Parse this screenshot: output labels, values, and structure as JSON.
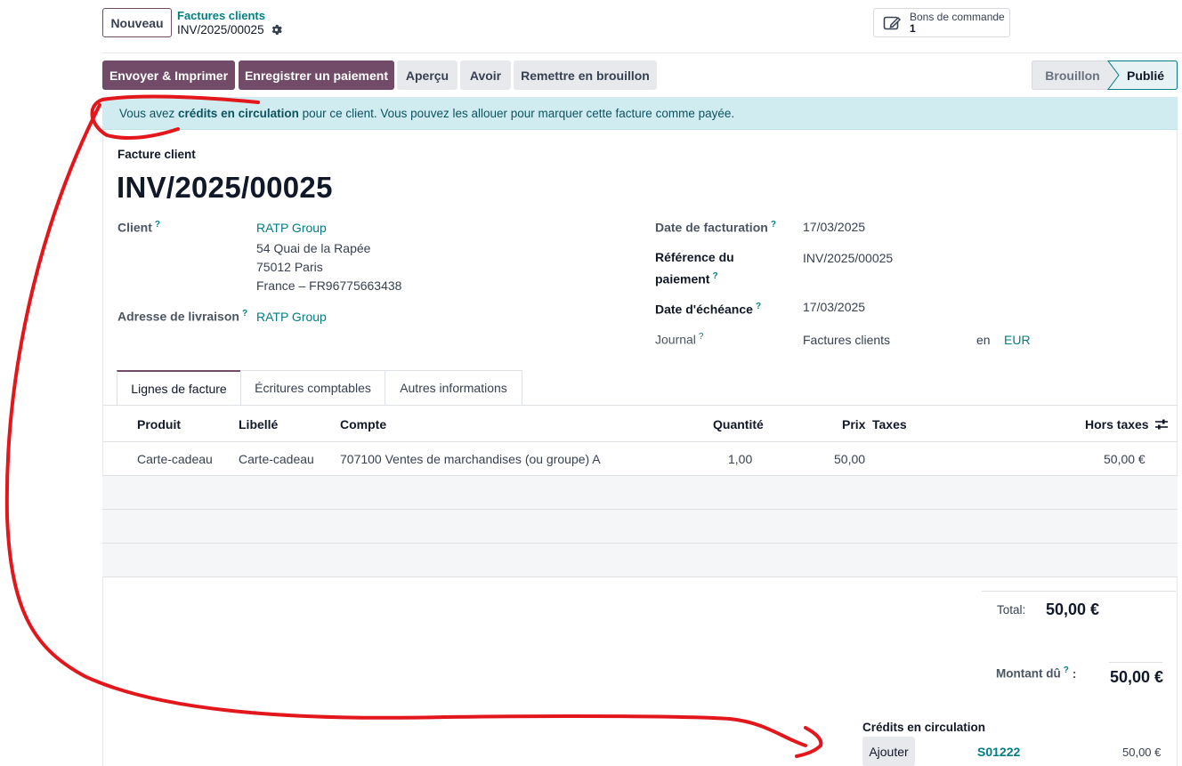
{
  "control": {
    "new_label": "Nouveau",
    "breadcrumb_parent": "Factures clients",
    "breadcrumb_current": "INV/2025/00025"
  },
  "smart_button": {
    "label": "Bons de commande",
    "count": "1"
  },
  "actions": {
    "send_print": "Envoyer & Imprimer",
    "register_payment": "Enregistrer un paiement",
    "preview": "Aperçu",
    "credit_note": "Avoir",
    "reset_draft": "Remettre en brouillon"
  },
  "status": {
    "stages": [
      "Brouillon",
      "Publié"
    ],
    "current": "Publié"
  },
  "alert": {
    "prefix": "Vous avez ",
    "bold": "crédits en circulation",
    "suffix": " pour ce client. Vous pouvez les allouer pour marquer cette facture comme payée."
  },
  "invoice": {
    "type_label": "Facture client",
    "name": "INV/2025/00025",
    "client_label": "Client",
    "client_name": "RATP Group",
    "address_line1": "54 Quai de la Rapée",
    "address_line2": "75012 Paris",
    "address_line3": "France – FR96775663438",
    "delivery_label": "Adresse de livraison",
    "delivery_value": "RATP Group",
    "date_label": "Date de facturation",
    "date_value": "17/03/2025",
    "payref_label_1": "Référence du",
    "payref_label_2": "paiement",
    "payref_value": "INV/2025/00025",
    "due_label": "Date d'échéance",
    "due_value": "17/03/2025",
    "journal_label": "Journal",
    "journal_value": "Factures clients",
    "in_label": "en",
    "currency": "EUR",
    "help_mark": "?"
  },
  "tabs": [
    "Lignes de facture",
    "Écritures comptables",
    "Autres informations"
  ],
  "table": {
    "headers": {
      "product": "Produit",
      "label": "Libellé",
      "account": "Compte",
      "quantity": "Quantité",
      "price": "Prix",
      "taxes": "Taxes",
      "subtotal": "Hors taxes"
    },
    "rows": [
      {
        "product": "Carte-cadeau",
        "label": "Carte-cadeau",
        "account": "707100 Ventes de marchandises (ou groupe) A",
        "quantity": "1,00",
        "price": "50,00",
        "taxes": "",
        "subtotal": "50,00 €"
      }
    ]
  },
  "totals": {
    "total_label": "Total:",
    "total_value": "50,00 €",
    "due_label": "Montant dû",
    "due_help": "?",
    "due_colon": ":",
    "due_value": "50,00 €"
  },
  "credits": {
    "title": "Crédits en circulation",
    "add_label": "Ajouter",
    "ref": "S01222",
    "amount": "50,00 €"
  },
  "colors": {
    "primary": "#714b67",
    "link": "#017e84",
    "alert_bg": "#d1ecf1",
    "annotation": "#e3161b"
  },
  "icons": [
    "gear-icon",
    "edit-icon",
    "column-settings-icon"
  ]
}
